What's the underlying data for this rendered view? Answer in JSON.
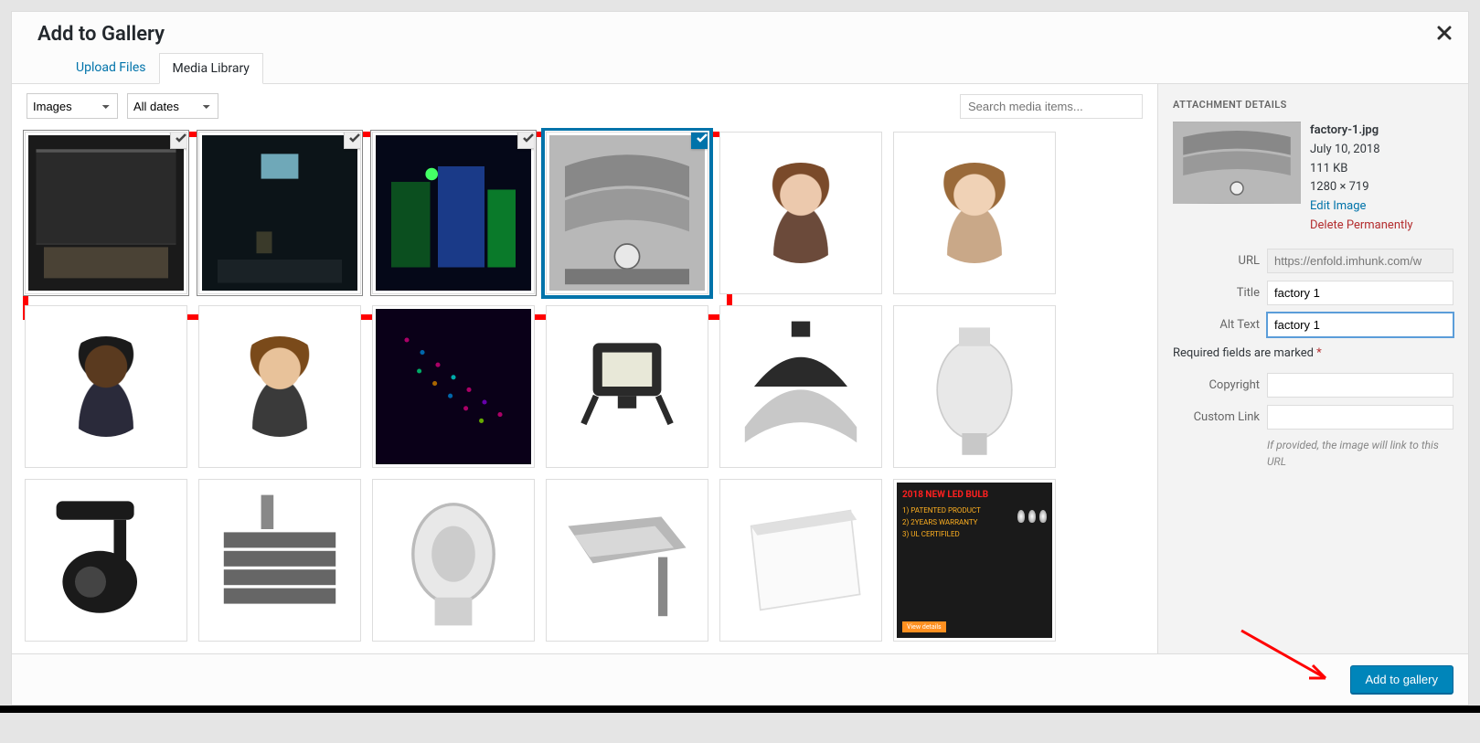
{
  "header": {
    "title": "Add to Gallery"
  },
  "tabs": [
    {
      "label": "Upload Files",
      "active": false
    },
    {
      "label": "Media Library",
      "active": true
    }
  ],
  "toolbar": {
    "filter_type": "Images",
    "filter_date": "All dates",
    "search_placeholder": "Search media items..."
  },
  "sidebar": {
    "heading": "ATTACHMENT DETAILS",
    "filename": "factory-1.jpg",
    "date": "July 10, 2018",
    "size": "111 KB",
    "dimensions": "1280 × 719",
    "edit_link": "Edit Image",
    "delete_link": "Delete Permanently",
    "fields": {
      "url_label": "URL",
      "url_value": "https://enfold.imhunk.com/w",
      "title_label": "Title",
      "title_value": "factory 1",
      "alt_label": "Alt Text",
      "alt_value": "factory 1",
      "copyright_label": "Copyright",
      "copyright_value": "",
      "customlink_label": "Custom Link",
      "customlink_value": ""
    },
    "required_note": "Required fields are marked ",
    "required_mark": "*",
    "customlink_hint": "If provided, the image will link to this URL"
  },
  "footer": {
    "submit_label": "Add to gallery"
  },
  "media": [
    {
      "kind": "factory-dark",
      "selected": true,
      "primary": false
    },
    {
      "kind": "factory-interior",
      "selected": true,
      "primary": false
    },
    {
      "kind": "factory-night",
      "selected": true,
      "primary": false
    },
    {
      "kind": "factory-pipes",
      "selected": true,
      "primary": true
    },
    {
      "kind": "avatar-f1",
      "selected": false
    },
    {
      "kind": "avatar-f2",
      "selected": false
    },
    {
      "kind": "avatar-m1",
      "selected": false
    },
    {
      "kind": "avatar-m2",
      "selected": false
    },
    {
      "kind": "led-matrix",
      "selected": false
    },
    {
      "kind": "floodlight",
      "selected": false
    },
    {
      "kind": "highbay",
      "selected": false
    },
    {
      "kind": "bulb",
      "selected": false
    },
    {
      "kind": "tracklight",
      "selected": false
    },
    {
      "kind": "panel-light",
      "selected": false
    },
    {
      "kind": "bulb-2",
      "selected": false
    },
    {
      "kind": "streetlight",
      "selected": false
    },
    {
      "kind": "flat-panel",
      "selected": false
    },
    {
      "kind": "led-ad",
      "selected": false
    }
  ],
  "led_ad": {
    "headline": "2018 NEW LED BULB",
    "line1": "1) PATENTED PRODUCT",
    "line2": "2) 2YEARS WARRANTY",
    "line3": "3) UL CERTIFILED",
    "button": "View details"
  }
}
